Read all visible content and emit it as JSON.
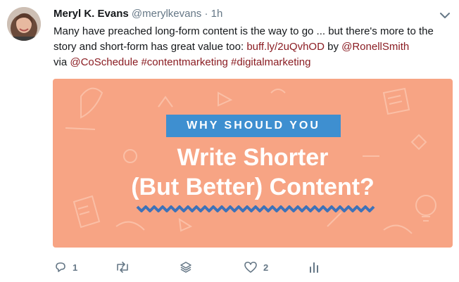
{
  "tweet": {
    "author_name": "Meryl K. Evans",
    "handle": "@merylkevans",
    "separator": "·",
    "time": "1h",
    "text_before_link": "Many have preached long-form content is the way to go ... but there's more to the story and short-form has great value too: ",
    "link_text": "buff.ly/2uQvhOD",
    "text_by": " by ",
    "mention_1": "@RonellSmith",
    "text_via": " via ",
    "mention_2": "@CoSchedule",
    "hashtag_1": "#contentmarketing",
    "hashtag_2": "#digitalmarketing"
  },
  "media": {
    "kicker": "WHY SHOULD YOU",
    "headline_line1": "Write Shorter",
    "headline_line2": "(But Better) Content?"
  },
  "actions": {
    "reply_count": "1",
    "like_count": "2"
  },
  "colors": {
    "media_background": "#f7a484",
    "kicker_background": "#3e8fd0",
    "link": "#8a1c22"
  },
  "icons": [
    "avatar",
    "chevron-down-icon",
    "reply-icon",
    "retweet-icon",
    "stack-icon",
    "heart-icon",
    "analytics-icon"
  ]
}
